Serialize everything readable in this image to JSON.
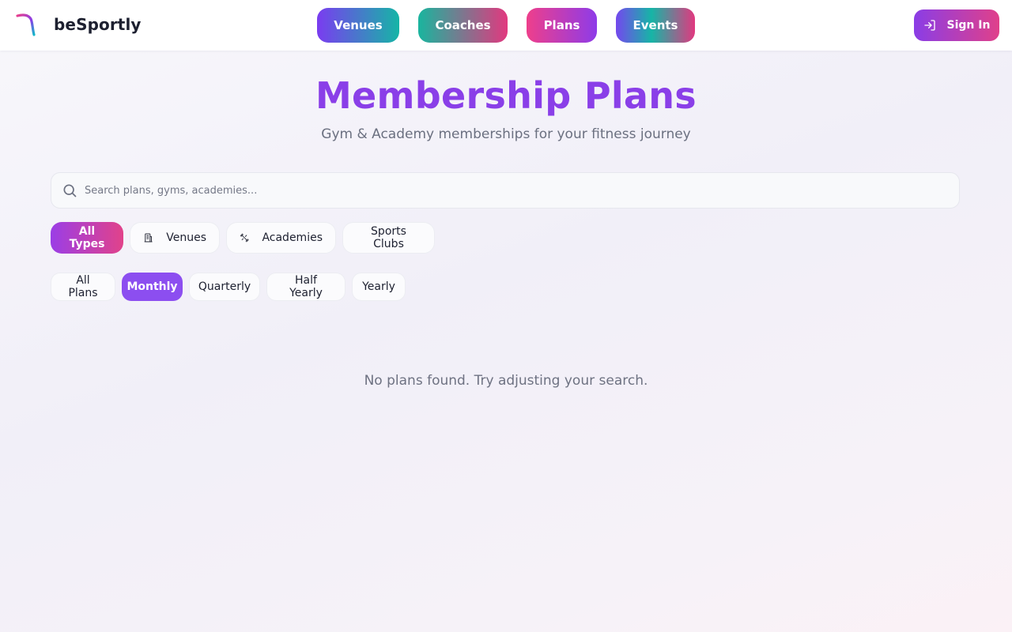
{
  "app": {
    "brand": "beSportly"
  },
  "nav": {
    "venues": "Venues",
    "coaches": "Coaches",
    "plans": "Plans",
    "events": "Events",
    "sign_in": "Sign In"
  },
  "hero": {
    "title": "Membership Plans",
    "subtitle": "Gym & Academy memberships for your fitness journey"
  },
  "search": {
    "placeholder": "Search plans, gyms, academies..."
  },
  "type_filters": {
    "all": "All Types",
    "venues": "Venues",
    "academies": "Academies",
    "clubs": "Sports Clubs",
    "selected": "All Types"
  },
  "period_filters": {
    "all": "All Plans",
    "monthly": "Monthly",
    "quarterly": "Quarterly",
    "half_yearly": "Half Yearly",
    "yearly": "Yearly",
    "selected": "Monthly"
  },
  "empty_state": "No plans found. Try adjusting your search.",
  "icons": {
    "logo": "besportly-logo-icon",
    "sign_in": "log-in-icon",
    "search": "search-icon",
    "venues": "building-icon",
    "academies": "dumbbell-icon"
  },
  "colors": {
    "accent": "#8a3fe8",
    "pink": "#e0408a",
    "teal": "#16b5a6",
    "period_active": "#8c4ef0"
  }
}
